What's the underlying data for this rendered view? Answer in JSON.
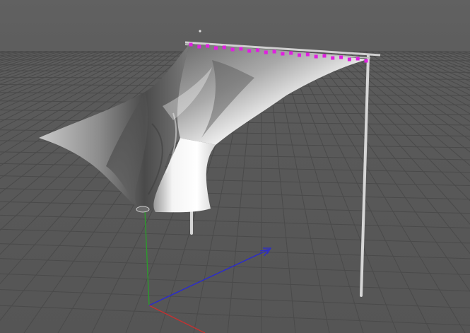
{
  "viewport": {
    "background_color": "#5b5b5b",
    "grid_color": "#4a4a4a",
    "axis_colors": {
      "x": "#c83030",
      "y": "#2c9a2c",
      "z": "#2a2ad0"
    }
  },
  "cloth": {
    "color": "#d8d8d8"
  },
  "rig": {
    "pole_color": "#d6d6d6",
    "pin_color": "#e020e0",
    "pin_count": 22
  }
}
